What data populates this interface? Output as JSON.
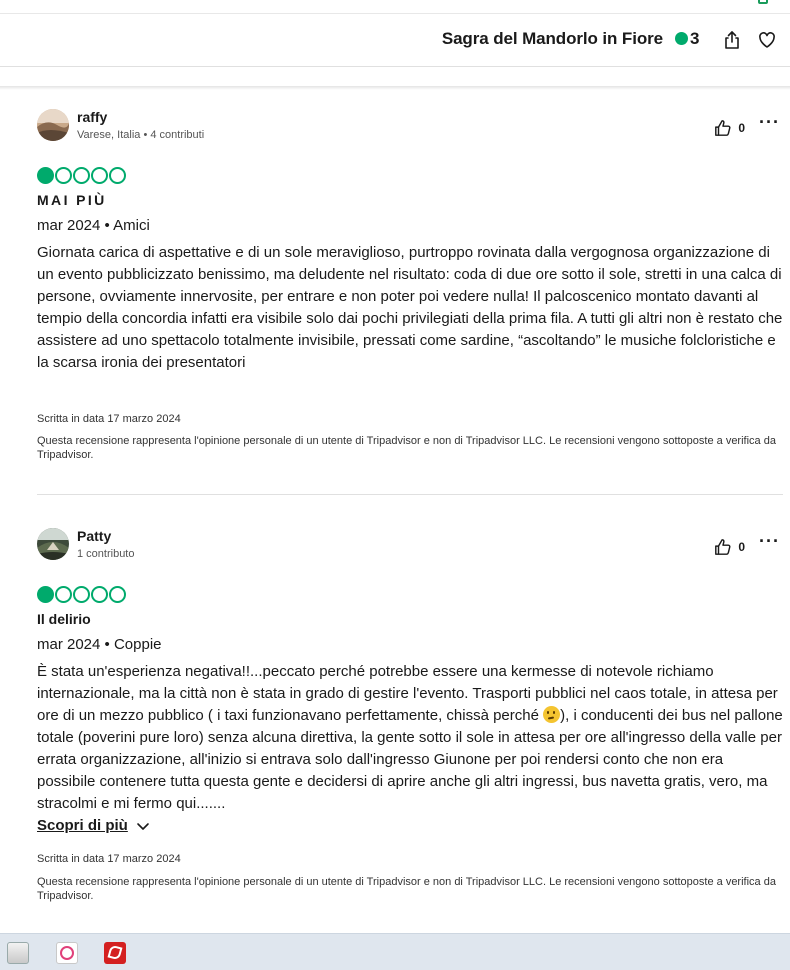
{
  "header": {
    "title": "Sagra del Mandorlo in Fiore",
    "rating": "3",
    "accent_color": "#00aa6c",
    "share_icon": "share-icon",
    "save_icon": "heart-icon"
  },
  "reviews": [
    {
      "username": "raffy",
      "userinfo": "Varese, Italia • 4 contributi",
      "votes": "0",
      "rating_bubbles": 1,
      "rating_max": 5,
      "title": "MAI PIÙ",
      "date_type": "mar 2024 • Amici",
      "body": "Giornata carica di aspettative e di un sole meraviglioso, purtroppo rovinata dalla vergognosa organizzazione di un evento pubblicizzato benissimo, ma deludente nel risultato: coda di due ore sotto il sole, stretti in una calca di persone, ovviamente innervosite, per entrare e non poter poi vedere nulla! Il palcoscenico montato davanti al tempio della concordia infatti era visibile solo dai pochi privilegiati della prima fila. A tutti gli altri non è restato che assistere ad uno spettacolo totalmente invisibile, pressati come sardine, “ascoltando” le musiche folcloristiche e la scarsa ironia dei presentatori",
      "written": "Scritta in data 17 marzo 2024",
      "disclaimer": "Questa recensione rappresenta l'opinione personale di un utente di Tripadvisor e non di Tripadvisor LLC. Le recensioni vengono sottoposte a verifica da Tripadvisor."
    },
    {
      "username": "Patty",
      "userinfo": "1 contributo",
      "votes": "0",
      "rating_bubbles": 1,
      "rating_max": 5,
      "title": "Il delirio",
      "date_type": "mar 2024 • Coppie",
      "body_part1": "È stata un'esperienza negativa!!...peccato perché potrebbe essere una kermesse di notevole richiamo internazionale, ma la città non è stata in grado di gestire l'evento. Trasporti pubblici nel caos totale, in attesa per ore di un mezzo pubblico ( i taxi funzionavano perfettamente, chissà perché ",
      "body_part2": "), i conducenti dei bus nel pallone totale (poverini pure loro) senza alcuna direttiva, la gente sotto il sole in attesa per ore all'ingresso della valle per errata organizzazione, all'inizio si entrava solo dall'ingresso Giunone per poi rendersi conto che non era possibile contenere tutta questa gente e decidersi di aprire anche gli altri ingressi, bus navetta gratis, vero, ma stracolmi e mi fermo qui.......",
      "emoji": "thinking-face-emoji",
      "read_more": "Scopri di più",
      "written": "Scritta in data 17 marzo 2024",
      "disclaimer": "Questa recensione rappresenta l'opinione personale di un utente di Tripadvisor e non di Tripadvisor LLC. Le recensioni vengono sottoposte a verifica da Tripadvisor."
    }
  ],
  "taskbar": {
    "items": [
      "explorer-icon",
      "itunes-icon",
      "acrobat-icon"
    ]
  }
}
